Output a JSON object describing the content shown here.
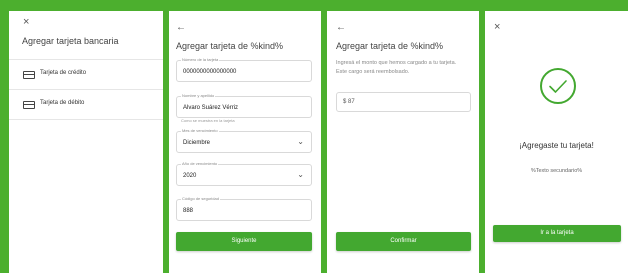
{
  "panel1": {
    "close_icon": "×",
    "title": "Agregar tarjeta bancaria",
    "items": [
      {
        "label": "Tarjeta de crédito",
        "icon": "credit-card-icon"
      },
      {
        "label": "Tarjeta de débito",
        "icon": "debit-card-icon"
      }
    ]
  },
  "panel2": {
    "back_icon": "←",
    "title": "Agregar tarjeta de %kind%",
    "fields": {
      "card_number": {
        "label": "Número de la tarjeta",
        "value": "0000000000000000"
      },
      "name": {
        "label": "Nombre y apellido",
        "value": "Alvaro Suárez Vérriz",
        "helper": "Como se muestra en la tarjeta"
      },
      "month": {
        "label": "Mes de vencimiento",
        "value": "Diciembre"
      },
      "year": {
        "label": "Año de vencimiento",
        "value": "2020"
      },
      "cvv": {
        "label": "Código de seguridad",
        "value": "888"
      }
    },
    "submit_label": "Siguiente"
  },
  "panel3": {
    "back_icon": "←",
    "title": "Agregar tarjeta de %kind%",
    "description": "Ingresá el monto que hemos cargado a tu tarjeta. Este cargo será reembolsado.",
    "amount_value": "$ 87",
    "confirm_label": "Confirmar"
  },
  "panel4": {
    "close_icon": "×",
    "success_title": "¡Agregaste tu tarjeta!",
    "secondary_text": "%Texto secundario%",
    "cta_label": "Ir a la tarjeta"
  },
  "colors": {
    "accent": "#43a830",
    "background": "#4caf2e"
  }
}
